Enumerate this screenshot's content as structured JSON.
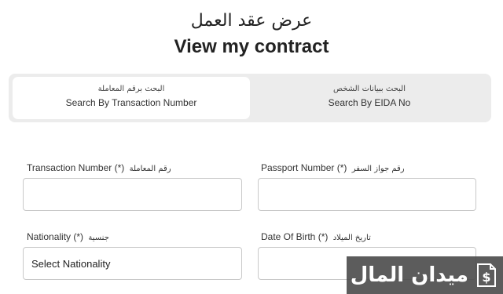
{
  "header": {
    "title_ar": "عرض عقد العمل",
    "title_en": "View my contract"
  },
  "tabs": [
    {
      "label_ar": "البحث برقم المعاملة",
      "label_en": "Search By Transaction Number",
      "active": true
    },
    {
      "label_ar": "البحث ببيانات الشخص",
      "label_en": "Search By EIDA No",
      "active": false
    }
  ],
  "form": {
    "transaction_number": {
      "label_en": "Transaction Number (*)",
      "label_ar": "رقم المعاملة",
      "value": ""
    },
    "passport_number": {
      "label_en": "Passport Number (*)",
      "label_ar": "رقم جواز السفر",
      "value": ""
    },
    "nationality": {
      "label_en": "Nationality (*)",
      "label_ar": "جنسية",
      "selected": "Select Nationality"
    },
    "date_of_birth": {
      "label_en": "Date Of Birth (*)",
      "label_ar": "تاريخ الميلاد",
      "value": ""
    }
  },
  "watermark": {
    "text": "ميدان المال",
    "icon": "dollar-document-icon"
  }
}
